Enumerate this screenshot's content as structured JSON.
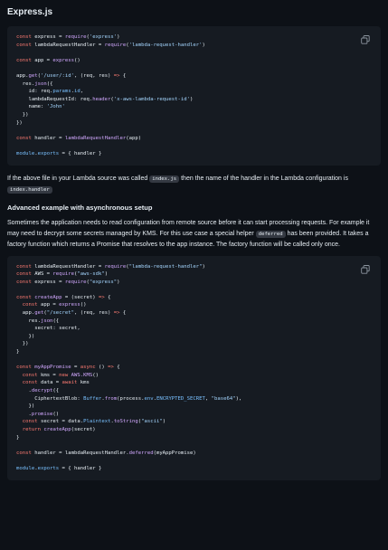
{
  "heading_express": "Express.js",
  "code1": [
    [
      [
        "k",
        "const"
      ],
      [
        "p",
        " express = "
      ],
      [
        "f",
        "require"
      ],
      [
        "p",
        "("
      ],
      [
        "s",
        "'express'"
      ],
      [
        "p",
        ")"
      ]
    ],
    [
      [
        "k",
        "const"
      ],
      [
        "p",
        " lambdaRequestHandler = "
      ],
      [
        "f",
        "require"
      ],
      [
        "p",
        "("
      ],
      [
        "s",
        "'lambda-request-handler'"
      ],
      [
        "p",
        ")"
      ]
    ],
    [],
    [
      [
        "k",
        "const"
      ],
      [
        "p",
        " app = "
      ],
      [
        "f",
        "express"
      ],
      [
        "p",
        "()"
      ]
    ],
    [],
    [
      [
        "p",
        "app."
      ],
      [
        "f",
        "get"
      ],
      [
        "p",
        "("
      ],
      [
        "s",
        "'/user/:id'"
      ],
      [
        "p",
        ", (req, res) "
      ],
      [
        "k",
        "=>"
      ],
      [
        "p",
        " {"
      ]
    ],
    [
      [
        "p",
        "  res."
      ],
      [
        "f",
        "json"
      ],
      [
        "p",
        "({"
      ]
    ],
    [
      [
        "p",
        "    id: req."
      ],
      [
        "c",
        "params"
      ],
      [
        "p",
        "."
      ],
      [
        "c",
        "id"
      ],
      [
        "p",
        ","
      ]
    ],
    [
      [
        "p",
        "    lambdaRequestId: req."
      ],
      [
        "f",
        "header"
      ],
      [
        "p",
        "("
      ],
      [
        "s",
        "'x-aws-lambda-request-id'"
      ],
      [
        "p",
        ")"
      ]
    ],
    [
      [
        "p",
        "    name: "
      ],
      [
        "s",
        "'John'"
      ]
    ],
    [
      [
        "p",
        "  })"
      ]
    ],
    [
      [
        "p",
        "})"
      ]
    ],
    [],
    [
      [
        "k",
        "const"
      ],
      [
        "p",
        " handler = "
      ],
      [
        "f",
        "lambdaRequestHandler"
      ],
      [
        "p",
        "(app)"
      ]
    ],
    [],
    [
      [
        "c",
        "module"
      ],
      [
        "p",
        "."
      ],
      [
        "c",
        "exports"
      ],
      [
        "p",
        " = { handler }"
      ]
    ]
  ],
  "para1": {
    "t1": "If the above file in your Lambda source was called ",
    "code_a": "index.js",
    "t2": " then the name of the handler in the Lambda configuration is ",
    "code_b": "index.handler"
  },
  "heading_async": "Advanced example with asynchronous setup",
  "para2": {
    "t1": "Sometimes the application needs to read configuration from remote source before it can start processing requests. For example it may need to decrypt some secrets managed by KMS. For this use case a special helper ",
    "code_a": "deferred",
    "t2": " has been provided. It takes a factory function which returns a Promise that resolves to the app instance. The factory function will be called only once."
  },
  "code2": [
    [
      [
        "k",
        "const"
      ],
      [
        "p",
        " lambdaRequestHandler = "
      ],
      [
        "f",
        "require"
      ],
      [
        "p",
        "("
      ],
      [
        "s",
        "\"lambda-request-handler\""
      ],
      [
        "p",
        ")"
      ]
    ],
    [
      [
        "k",
        "const"
      ],
      [
        "p",
        " AWS = "
      ],
      [
        "f",
        "require"
      ],
      [
        "p",
        "("
      ],
      [
        "s",
        "\"aws-sdk\""
      ],
      [
        "p",
        ")"
      ]
    ],
    [
      [
        "k",
        "const"
      ],
      [
        "p",
        " express = "
      ],
      [
        "f",
        "require"
      ],
      [
        "p",
        "("
      ],
      [
        "s",
        "\"express\""
      ],
      [
        "p",
        ")"
      ]
    ],
    [],
    [
      [
        "k",
        "const"
      ],
      [
        "p",
        " "
      ],
      [
        "f",
        "createApp"
      ],
      [
        "p",
        " = (secret) "
      ],
      [
        "k",
        "=>"
      ],
      [
        "p",
        " {"
      ]
    ],
    [
      [
        "p",
        "  "
      ],
      [
        "k",
        "const"
      ],
      [
        "p",
        " app = "
      ],
      [
        "f",
        "express"
      ],
      [
        "p",
        "()"
      ]
    ],
    [
      [
        "p",
        "  app."
      ],
      [
        "f",
        "get"
      ],
      [
        "p",
        "("
      ],
      [
        "s",
        "\"/secret\""
      ],
      [
        "p",
        ", (req, res) "
      ],
      [
        "k",
        "=>"
      ],
      [
        "p",
        " {"
      ]
    ],
    [
      [
        "p",
        "    res."
      ],
      [
        "f",
        "json"
      ],
      [
        "p",
        "({"
      ]
    ],
    [
      [
        "p",
        "      secret: secret,"
      ]
    ],
    [
      [
        "p",
        "    })"
      ]
    ],
    [
      [
        "p",
        "  })"
      ]
    ],
    [
      [
        "p",
        "}"
      ]
    ],
    [],
    [
      [
        "k",
        "const"
      ],
      [
        "p",
        " "
      ],
      [
        "f",
        "myAppPromise"
      ],
      [
        "p",
        " = "
      ],
      [
        "k",
        "async"
      ],
      [
        "p",
        " () "
      ],
      [
        "k",
        "=>"
      ],
      [
        "p",
        " {"
      ]
    ],
    [
      [
        "p",
        "  "
      ],
      [
        "k",
        "const"
      ],
      [
        "p",
        " kms = "
      ],
      [
        "k",
        "new"
      ],
      [
        "p",
        " "
      ],
      [
        "f",
        "AWS.KMS"
      ],
      [
        "p",
        "()"
      ]
    ],
    [
      [
        "p",
        "  "
      ],
      [
        "k",
        "const"
      ],
      [
        "p",
        " data = "
      ],
      [
        "k",
        "await"
      ],
      [
        "p",
        " kms"
      ]
    ],
    [
      [
        "p",
        "    ."
      ],
      [
        "f",
        "decrypt"
      ],
      [
        "p",
        "({"
      ]
    ],
    [
      [
        "p",
        "      CiphertextBlob: "
      ],
      [
        "c",
        "Buffer"
      ],
      [
        "p",
        "."
      ],
      [
        "f",
        "from"
      ],
      [
        "p",
        "(process."
      ],
      [
        "c",
        "env"
      ],
      [
        "p",
        "."
      ],
      [
        "c",
        "ENCRYPTED_SECRET"
      ],
      [
        "p",
        ", "
      ],
      [
        "s",
        "\"base64\""
      ],
      [
        "p",
        "),"
      ]
    ],
    [
      [
        "p",
        "    })"
      ]
    ],
    [
      [
        "p",
        "    ."
      ],
      [
        "f",
        "promise"
      ],
      [
        "p",
        "()"
      ]
    ],
    [
      [
        "p",
        "  "
      ],
      [
        "k",
        "const"
      ],
      [
        "p",
        " secret = data."
      ],
      [
        "c",
        "Plaintext"
      ],
      [
        "p",
        "."
      ],
      [
        "f",
        "toString"
      ],
      [
        "p",
        "("
      ],
      [
        "s",
        "\"ascii\""
      ],
      [
        "p",
        ")"
      ]
    ],
    [
      [
        "p",
        "  "
      ],
      [
        "k",
        "return"
      ],
      [
        "p",
        " "
      ],
      [
        "f",
        "createApp"
      ],
      [
        "p",
        "(secret)"
      ]
    ],
    [
      [
        "p",
        "}"
      ]
    ],
    [],
    [
      [
        "k",
        "const"
      ],
      [
        "p",
        " handler = lambdaRequestHandler."
      ],
      [
        "f",
        "deferred"
      ],
      [
        "p",
        "(myAppPromise)"
      ]
    ],
    [],
    [
      [
        "c",
        "module"
      ],
      [
        "p",
        "."
      ],
      [
        "c",
        "exports"
      ],
      [
        "p",
        " = { handler }"
      ]
    ]
  ],
  "icons": {
    "copy": "copy-icon"
  },
  "colors": {
    "background": "#0d1117",
    "code_background": "#161b22",
    "keyword": "#ff7b72",
    "string": "#a5d6ff",
    "function": "#d2a8ff",
    "constant": "#79c0ff"
  }
}
